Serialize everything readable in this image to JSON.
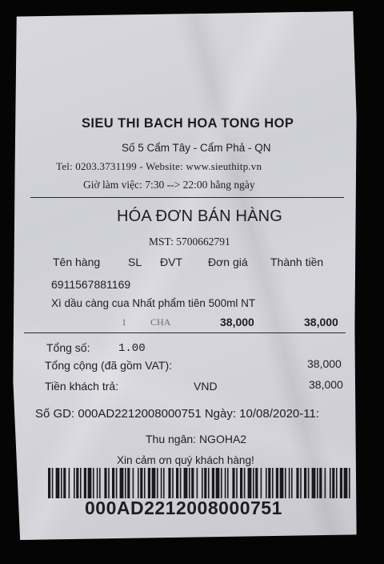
{
  "receipt": {
    "store_name": "SIEU THI BACH HOA TONG HOP",
    "address": "Số 5 Cẩm Tây - Cẩm Phả - QN",
    "contact": "Tel:  0203.3731199 - Website:  www.sieuthitp.vn",
    "hours": "Giờ làm việc: 7:30  --> 22:00 hằng ngày",
    "title": "HÓA ĐƠN BÁN HÀNG",
    "tax_id": "MST: 5700662791",
    "columns": [
      "Tên hàng",
      "SL",
      "ĐVT",
      "Đơn giá",
      "Thành tiền"
    ],
    "item": {
      "code": "6911567881169",
      "name": "Xì dầu càng cua Nhất phẩm tiên 500ml  NT",
      "qty": "1",
      "unit": "CHA",
      "unit_price": "38,000",
      "line_total": "38,000"
    },
    "total_qty_label": "Tổng số:",
    "total_qty_value": "1.00",
    "grand_total_label": "Tổng cộng (đã gồm VAT):",
    "grand_total_value": "38,000",
    "paid_label": "Tiền khách trả:",
    "currency": "VND",
    "paid_value": "38,000",
    "transaction_line": "Số GD: 000AD2212008000751 Ngày: 10/08/2020-11:",
    "cashier": "Thu ngân: NGOHA2",
    "thanks": "Xin cảm ơn quý khách hàng!",
    "barcode_number": "000AD2212008000751"
  }
}
